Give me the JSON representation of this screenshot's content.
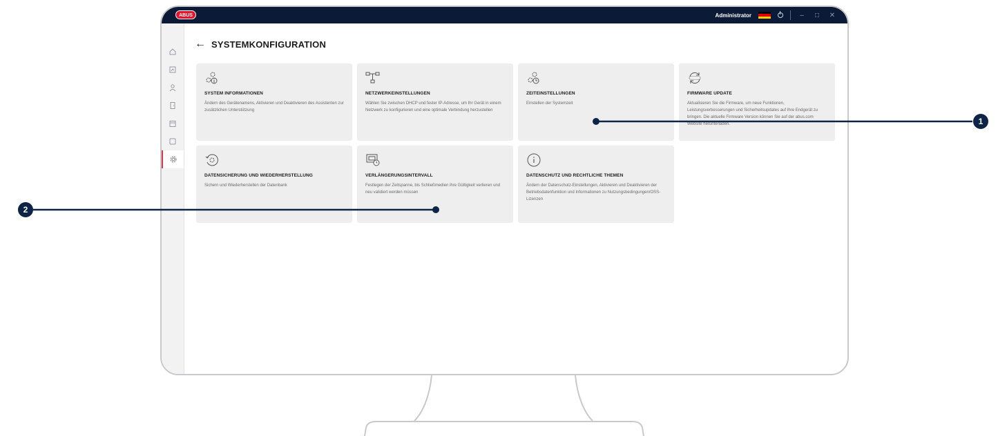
{
  "header": {
    "logo": "ABUS",
    "user": "Administrator",
    "flag_colors": [
      "#000000",
      "#dd0000",
      "#ffce00"
    ]
  },
  "page": {
    "title": "SYSTEMKONFIGURATION"
  },
  "tiles": [
    {
      "title": "SYSTEM INFORMATIONEN",
      "description": "Ändern des Gerätenamens, Aktivieren und Deaktivieren des Assistenten zur zusätzlichen Unterstützung",
      "icon": "gears-info-icon"
    },
    {
      "title": "NETZWERKEINSTELLUNGEN",
      "description": "Wählen Sie zwischen DHCP und fester IP-Adresse, um Ihr Gerät in einem Netzwerk zu konfigurieren und eine optimale Verbindung herzustellen",
      "icon": "network-icon"
    },
    {
      "title": "ZEITEINSTELLUNGEN",
      "description": "Einstellen der Systemzeit",
      "icon": "gears-clock-icon"
    },
    {
      "title": "FIRMWARE UPDATE",
      "description": "Aktualisieren Sie die Firmware, um neue Funktionen, Leistungsverbesserungen und Sicherheitsupdates auf Ihre Endgerät zu bringen. Die aktuelle Firmware Version können Sie auf der abus.com Website herunterladen.",
      "icon": "update-icon"
    },
    {
      "title": "DATENSICHERUNG UND WIEDERHERSTELLUNG",
      "description": "Sichern und Wiederherstellen der Datenbank",
      "icon": "backup-restore-icon"
    },
    {
      "title": "VERLÄNGERUNGSINTERVALL",
      "description": "Festlegen der Zeitspanne, bis Schließmedien ihre Gültigkeit verlieren und neu validiert werden müssen",
      "icon": "monitor-clock-icon"
    },
    {
      "title": "DATENSCHUTZ UND RECHTLICHE THEMEN",
      "description": "Ändern der Datenschutz-Einstellungen, Aktivieren und Deaktivieren der Betriebsdatenfunktion und Informationen zu Nutzungsbedingungen/OSS-Lizenzen",
      "icon": "info-icon"
    }
  ],
  "callouts": [
    "1",
    "2"
  ],
  "colors": {
    "topbar": "#0b1a36",
    "callout": "#0d2446",
    "accent": "#d43a4a",
    "logo": "#e4142c"
  }
}
